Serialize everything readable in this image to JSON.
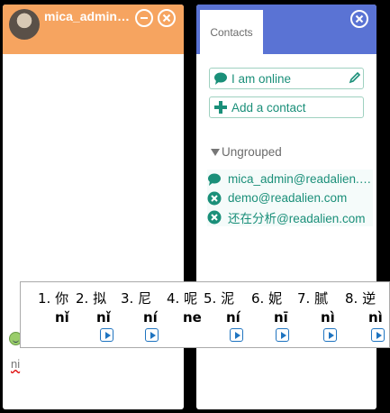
{
  "chat": {
    "title": "mica_admin@readalien.com",
    "input_text": "ni"
  },
  "contacts": {
    "tab_label": "Contacts",
    "status_label": "I am online",
    "add_label": "Add a contact",
    "group_label": "Ungrouped",
    "items": [
      {
        "name": "mica_admin@readalien.com",
        "status": "online"
      },
      {
        "name": "demo@readalien.com",
        "status": "offline"
      },
      {
        "name": "还在分析@readalien.com",
        "status": "offline"
      }
    ]
  },
  "ime": {
    "candidates": [
      {
        "num": "1.",
        "hanzi": "你",
        "pinyin": "nǐ",
        "has_audio": false
      },
      {
        "num": "2.",
        "hanzi": "拟",
        "pinyin": "nǐ",
        "has_audio": true
      },
      {
        "num": "3.",
        "hanzi": "尼",
        "pinyin": "ní",
        "has_audio": true
      },
      {
        "num": "4.",
        "hanzi": "呢",
        "pinyin": "ne",
        "has_audio": false
      },
      {
        "num": "5.",
        "hanzi": "泥",
        "pinyin": "ní",
        "has_audio": true
      },
      {
        "num": "6.",
        "hanzi": "妮",
        "pinyin": "nī",
        "has_audio": true
      },
      {
        "num": "7.",
        "hanzi": "腻",
        "pinyin": "nì",
        "has_audio": true
      },
      {
        "num": "8.",
        "hanzi": "逆",
        "pinyin": "nì",
        "has_audio": true
      }
    ]
  },
  "colors": {
    "chat_header": "#f6a460",
    "contacts_header": "#5a73d4",
    "accent_text": "#1a8f79",
    "audio_icon": "#1f74c0"
  }
}
